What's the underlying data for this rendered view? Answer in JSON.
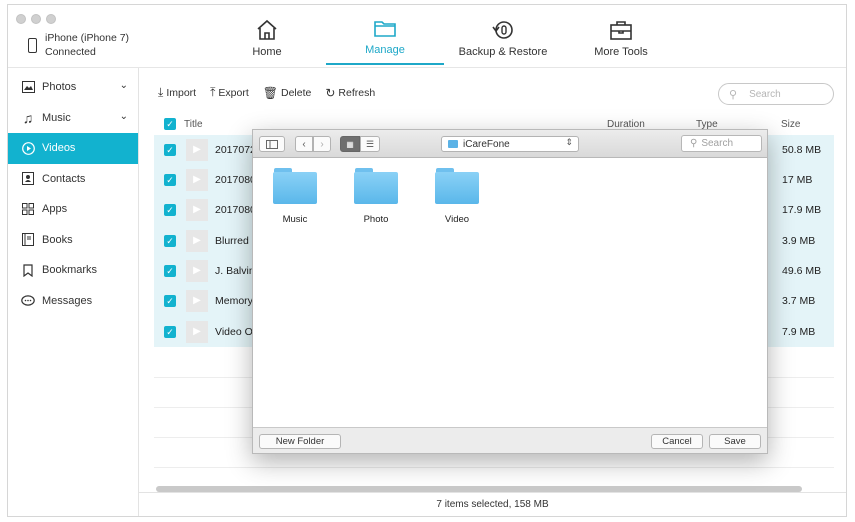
{
  "device": {
    "name": "iPhone (iPhone 7)",
    "status": "Connected"
  },
  "nav": [
    {
      "label": "Home",
      "icon": "home-icon"
    },
    {
      "label": "Manage",
      "icon": "folder-icon",
      "active": true
    },
    {
      "label": "Backup & Restore",
      "icon": "restore-icon"
    },
    {
      "label": "More Tools",
      "icon": "toolbox-icon"
    }
  ],
  "sidebar": [
    {
      "label": "Photos",
      "icon": "photo-icon",
      "expandable": true
    },
    {
      "label": "Music",
      "icon": "music-icon",
      "expandable": true
    },
    {
      "label": "Videos",
      "icon": "play-icon",
      "active": true
    },
    {
      "label": "Contacts",
      "icon": "contacts-icon"
    },
    {
      "label": "Apps",
      "icon": "apps-icon"
    },
    {
      "label": "Books",
      "icon": "book-icon"
    },
    {
      "label": "Bookmarks",
      "icon": "bookmark-icon"
    },
    {
      "label": "Messages",
      "icon": "message-icon"
    }
  ],
  "toolbar": {
    "import": "Import",
    "export": "Export",
    "delete": "Delete",
    "refresh": "Refresh"
  },
  "search": {
    "placeholder": "Search"
  },
  "table": {
    "columns": {
      "title": "Title",
      "duration": "Duration",
      "type": "Type",
      "size": "Size"
    },
    "rows": [
      {
        "title": "2017072",
        "size": "50.8 MB"
      },
      {
        "title": "2017080",
        "size": "17 MB"
      },
      {
        "title": "2017080",
        "size": "17.9 MB"
      },
      {
        "title": "Blurred B",
        "size": "3.9 MB"
      },
      {
        "title": "J. Balvin",
        "size": "49.6 MB"
      },
      {
        "title": "Memory",
        "size": "3.7 MB"
      },
      {
        "title": "Video Of",
        "size": "7.9 MB"
      }
    ]
  },
  "status": "7 items selected, 158 MB",
  "dialog": {
    "location": "iCareFone",
    "search_placeholder": "Search",
    "folders": [
      "Music",
      "Photo",
      "Video"
    ],
    "new_folder": "New Folder",
    "cancel": "Cancel",
    "save": "Save"
  },
  "colors": {
    "accent": "#12b2cf",
    "selected_row": "#e4f4f8",
    "folder": "#5ab7ea"
  }
}
